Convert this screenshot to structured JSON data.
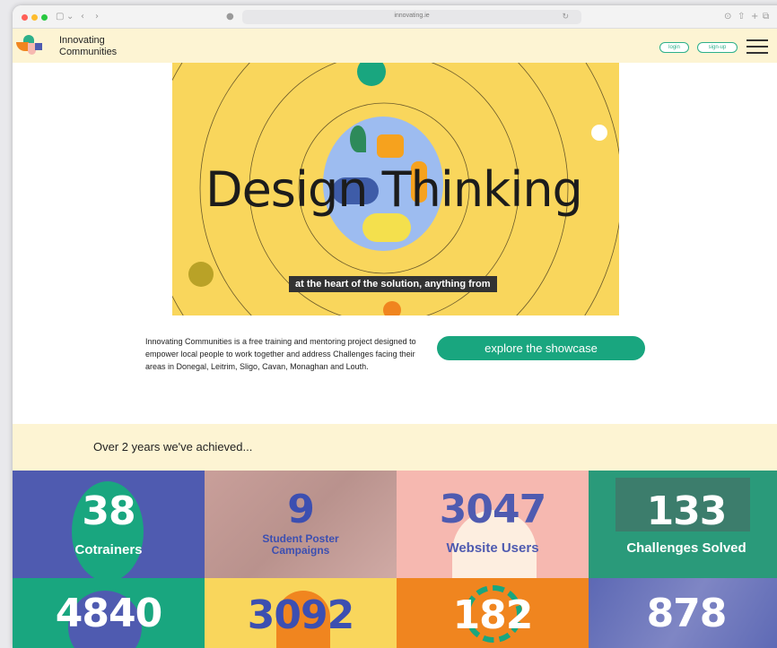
{
  "browser": {
    "url": "innovating.ie"
  },
  "header": {
    "brand_line1": "Innovating",
    "brand_line2": "Communities",
    "login_label": "login",
    "signup_label": "sign-up"
  },
  "hero": {
    "title": "Design Thinking",
    "caption": "at the heart of the solution, anything from"
  },
  "intro": {
    "text": "Innovating Communities is a free training and mentoring project designed to empower local people to work together and address Challenges facing their areas in Donegal, Leitrim, Sligo, Cavan, Monaghan and Louth.",
    "button_label": "explore the showcase"
  },
  "achievements": {
    "heading": "Over 2 years we've achieved...",
    "stats": [
      {
        "number": "38",
        "label": "Cotrainers"
      },
      {
        "number": "9",
        "label": "Student Poster Campaigns"
      },
      {
        "number": "3047",
        "label": "Website Users"
      },
      {
        "number": "133",
        "label": "Challenges Solved"
      },
      {
        "number": "4840",
        "label": ""
      },
      {
        "number": "3092",
        "label": ""
      },
      {
        "number": "182",
        "label": ""
      },
      {
        "number": "878",
        "label": ""
      }
    ]
  },
  "colors": {
    "accent_green": "#19a67f",
    "hero_yellow": "#f9d65c",
    "band_cream": "#fdf4d3",
    "tile_blue": "#4f5bb0",
    "tile_pink": "#f6b8b0",
    "tile_orange": "#f0851f"
  }
}
